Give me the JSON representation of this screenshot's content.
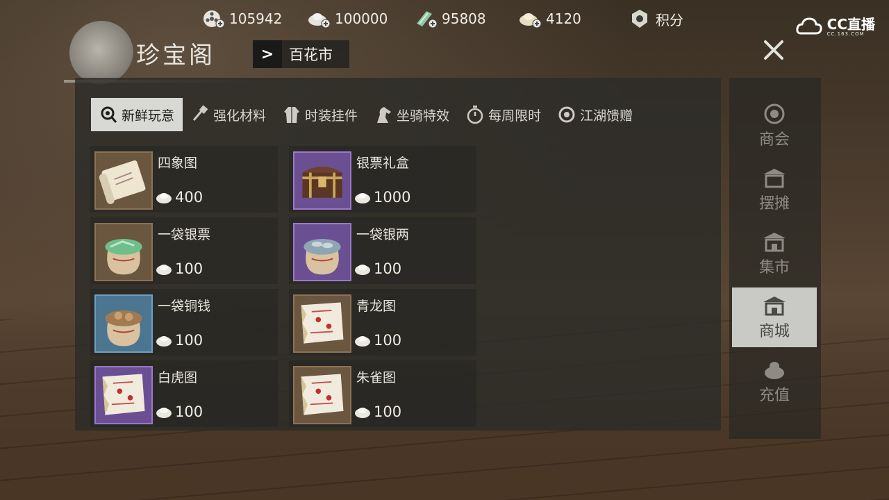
{
  "currencies": [
    {
      "name": "film-reel-currency",
      "value": "105942"
    },
    {
      "name": "silver-ingot-currency",
      "value": "100000"
    },
    {
      "name": "jade-currency",
      "value": "95808"
    },
    {
      "name": "gold-ingot-currency",
      "value": "4120"
    },
    {
      "name": "points",
      "value": "积分"
    }
  ],
  "logo": {
    "text": "CC直播",
    "sub": "CC.163.COM"
  },
  "shop": {
    "title": "珍宝阁",
    "breadcrumb": "百花市"
  },
  "tabs": [
    {
      "label": "新鲜玩意",
      "icon": "magnifier-icon",
      "active": true
    },
    {
      "label": "强化材料",
      "icon": "hammer-icon"
    },
    {
      "label": "时装挂件",
      "icon": "robe-icon"
    },
    {
      "label": "坐骑特效",
      "icon": "horse-icon"
    },
    {
      "label": "每周限时",
      "icon": "stopwatch-icon"
    },
    {
      "label": "江湖馈赠",
      "icon": "ring-icon"
    }
  ],
  "items": [
    {
      "name": "四象图",
      "price": "400",
      "icon": "scroll-icon"
    },
    {
      "name": "银票礼盒",
      "price": "1000",
      "icon": "chest-icon"
    },
    {
      "name": "一袋银票",
      "price": "100",
      "icon": "sack-notes-icon"
    },
    {
      "name": "一袋银两",
      "price": "100",
      "icon": "sack-silver-icon"
    },
    {
      "name": "一袋铜钱",
      "price": "100",
      "icon": "sack-copper-icon"
    },
    {
      "name": "青龙图",
      "price": "100",
      "icon": "map-icon"
    },
    {
      "name": "白虎图",
      "price": "100",
      "icon": "map-icon"
    },
    {
      "name": "朱雀图",
      "price": "100",
      "icon": "map-icon"
    }
  ],
  "sidebar": [
    {
      "label": "商会",
      "icon": "guild-icon"
    },
    {
      "label": "摆摊",
      "icon": "stall-icon"
    },
    {
      "label": "集市",
      "icon": "market-icon"
    },
    {
      "label": "商城",
      "icon": "mall-icon",
      "active": true
    },
    {
      "label": "充值",
      "icon": "recharge-icon"
    }
  ],
  "colors": {
    "active_tab_bg": "#d8d8d4",
    "purple_frame": "#9b79c8",
    "brown_frame": "#8a7256",
    "blue_frame": "#6e9fbd"
  }
}
